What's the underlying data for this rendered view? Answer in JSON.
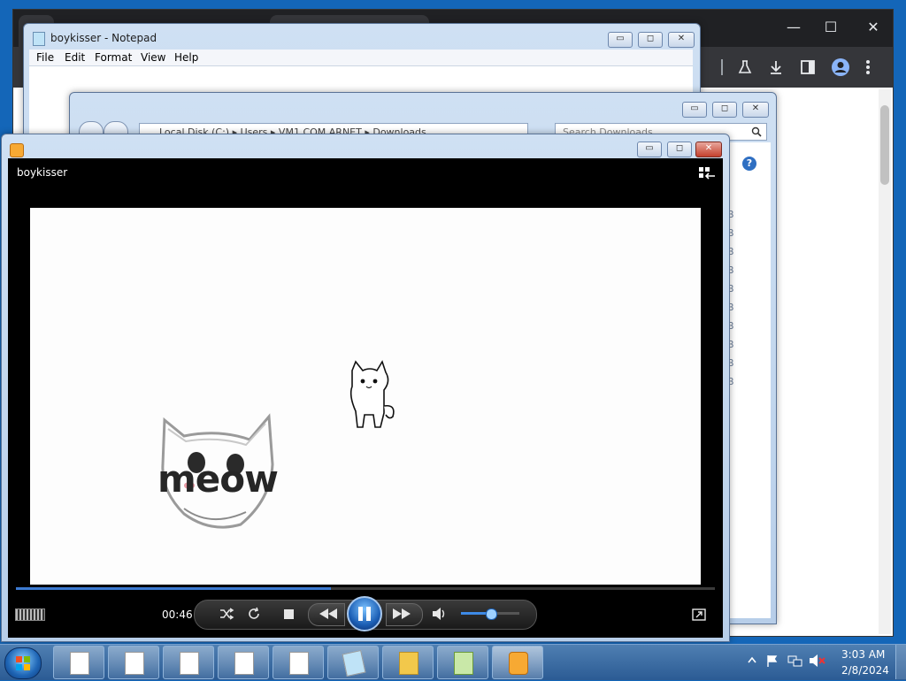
{
  "notepad": {
    "title": "boykisser - Notepad",
    "menu": [
      "File",
      "Edit",
      "Format",
      "View",
      "Help"
    ],
    "buttons": {
      "minimize": "▭",
      "maximize": "◻",
      "close": "✕"
    }
  },
  "explorer": {
    "address": "Local Disk (C:) ▸ Users ▸ VM1.COM.ARNET ▸ Downloads",
    "search_placeholder": "Search Downloads",
    "size_cells": [
      "B",
      "B",
      "B",
      "B",
      "B",
      "B",
      "B",
      "B",
      "B",
      "B"
    ]
  },
  "chrome": {
    "controls": {
      "minimize": "—",
      "maximize": "☐",
      "close": "✕"
    }
  },
  "wmp": {
    "caption": "boykisser",
    "video_text": "meow",
    "time": "00:46",
    "progress_fraction": 0.45,
    "volume_fraction": 0.5,
    "icons": [
      "shuffle-icon",
      "repeat-icon",
      "stop-icon",
      "previous-icon",
      "pause-icon",
      "next-icon",
      "volume-icon",
      "switch-to-now-playing-icon",
      "library-icon"
    ]
  },
  "taskbar": {
    "clock_time": "3:03 AM",
    "clock_date": "2/8/2024"
  }
}
